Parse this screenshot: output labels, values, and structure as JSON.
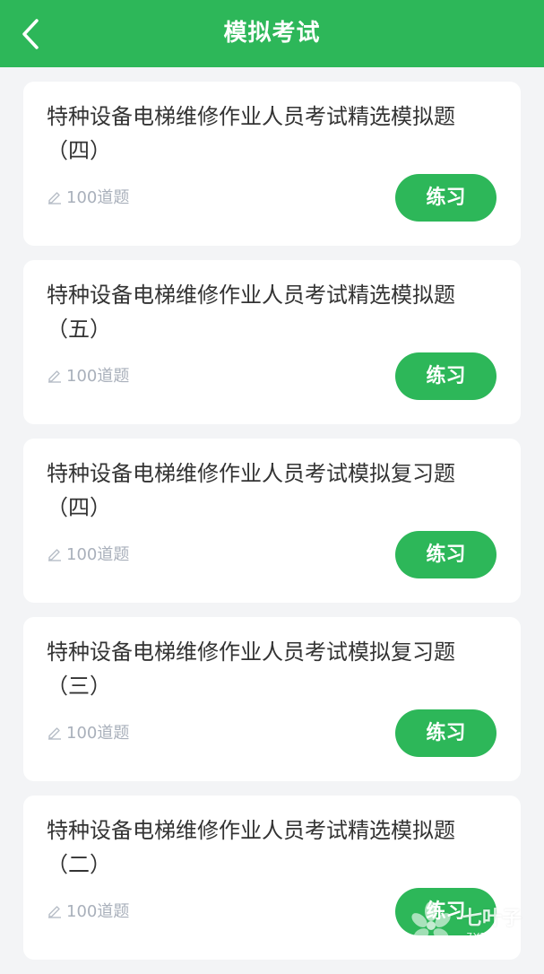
{
  "header": {
    "title": "模拟考试",
    "background_color": "#2db759"
  },
  "exams": [
    {
      "title": "特种设备电梯维修作业人员考试精选模拟题（四）",
      "count": "100道题",
      "button": "练习"
    },
    {
      "title": "特种设备电梯维修作业人员考试精选模拟题（五）",
      "count": "100道题",
      "button": "练习"
    },
    {
      "title": "特种设备电梯维修作业人员考试模拟复习题（四）",
      "count": "100道题",
      "button": "练习"
    },
    {
      "title": "特种设备电梯维修作业人员考试模拟复习题（三）",
      "count": "100道题",
      "button": "练习"
    },
    {
      "title": "特种设备电梯维修作业人员考试精选模拟题（二）",
      "count": "100道题",
      "button": "练习"
    }
  ],
  "watermark": {
    "main": "七叶子",
    "sub": "7YZ.COM"
  },
  "icons": {
    "back": "chevron-left-icon",
    "count": "pencil-icon",
    "watermark": "leaf-logo-icon"
  }
}
